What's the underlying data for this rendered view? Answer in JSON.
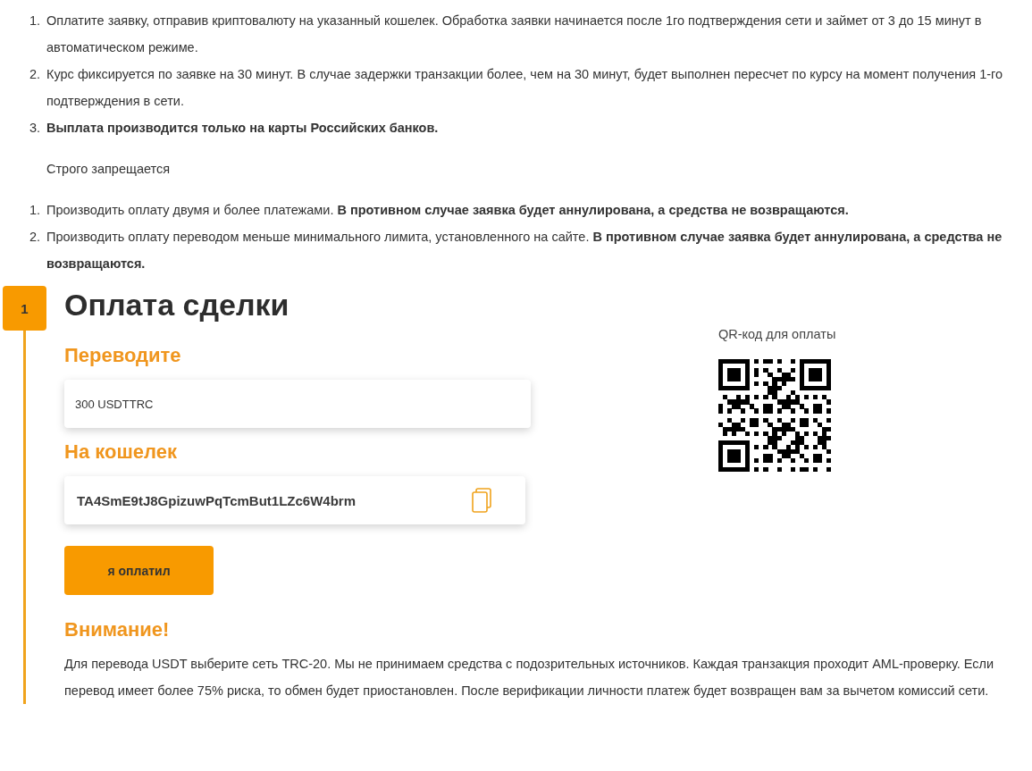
{
  "rules": [
    {
      "number": "1.",
      "text": "Оплатите заявку, отправив криптовалюту на указанный кошелек. Обработка заявки начинается после 1го подтверждения сети и займет от 3 до 15 минут в автоматическом режиме."
    },
    {
      "number": "2.",
      "text": "Курс фиксируется по заявке на 30 минут. В случае задержки транзакции более, чем на 30 минут, будет выполнен пересчет по курсу на момент получения 1-го подтверждения в сети."
    },
    {
      "number": "3.",
      "text": "**Выплата производится только на карты Российских банков.**"
    }
  ],
  "forbidden_title": "Строго запрещается",
  "forbidden": [
    {
      "number": "1.",
      "text": "Производить оплату двумя и более платежами. **В противном случае заявка будет аннулирована, а средства не возвращаются.**"
    },
    {
      "number": "2.",
      "text": "Производить оплату переводом меньше минимального лимита, установленного на сайте. **В противном случае заявка будет аннулирована, а средства не возвращаются.**"
    }
  ],
  "step": {
    "number": "1",
    "title": "Оплата сделки"
  },
  "transfer": {
    "label": "Переводите",
    "value": "300 USDTTRC"
  },
  "wallet": {
    "label": "На кошелек",
    "value": "TA4SmE9tJ8GpizuwPqTcmBut1LZc6W4brm"
  },
  "qr": {
    "label": "QR-код для оплаты"
  },
  "paid_button": "я оплатил",
  "warning": {
    "title": "Внимание!",
    "text": "Для перевода USDT выберите сеть TRC-20. Мы не принимаем средства с подозрительных источников. Каждая транзакция проходит AML-проверку. Если перевод имеет более 75% риска, то обмен будет приостановлен. После верификации личности платеж будет возвращен вам за вычетом комиссий сети."
  }
}
